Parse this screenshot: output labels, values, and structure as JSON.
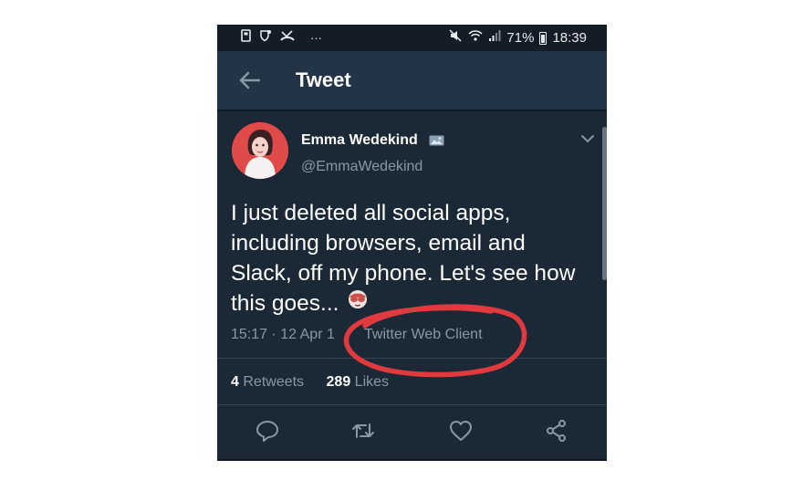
{
  "status_bar": {
    "notif_icons": [
      "storage-icon",
      "shield-icon",
      "missed-call-icon"
    ],
    "more": "···",
    "battery": "71%",
    "time": "18:39"
  },
  "header": {
    "title": "Tweet"
  },
  "tweet": {
    "author_name": "Emma Wedekind",
    "handle": "@EmmaWedekind",
    "lines": [
      "I just deleted all social apps,",
      "including browsers, email and",
      "Slack, off my phone. Let's see how",
      "this goes..."
    ],
    "time": "15:17 · 12 Apr 1",
    "source": "Twitter Web Client"
  },
  "stats": {
    "retweets_count": "4",
    "retweets_label": "Retweets",
    "likes_count": "289",
    "likes_label": "Likes"
  },
  "actions": [
    "reply-icon",
    "retweet-icon",
    "like-icon",
    "share-icon"
  ],
  "colors": {
    "background": "#1b2836",
    "header": "#243447",
    "text_secondary": "#8899a6",
    "annotation": "#e0393e"
  }
}
